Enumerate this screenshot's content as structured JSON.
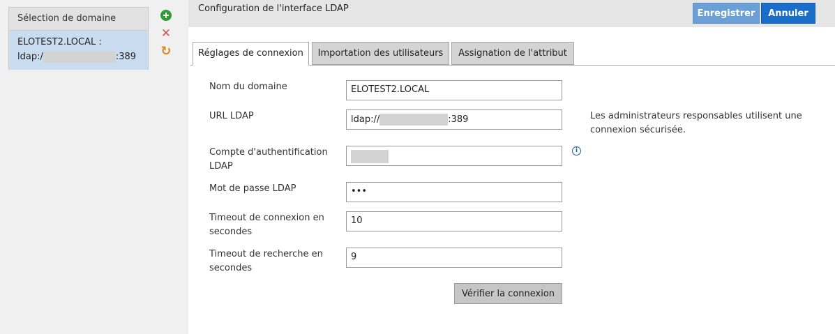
{
  "sidebar": {
    "header": "Sélection de domaine",
    "item_line1": "ELOTEST2.LOCAL :",
    "item_prefix": "ldap:/",
    "item_suffix": ":389"
  },
  "header": {
    "title": "Configuration de l'interface LDAP",
    "save_label": "Enregistrer",
    "cancel_label": "Annuler"
  },
  "tabs": [
    {
      "label": "Réglages de connexion",
      "active": true
    },
    {
      "label": "Importation des utilisateurs",
      "active": false
    },
    {
      "label": "Assignation de l'attribut",
      "active": false
    }
  ],
  "form": {
    "domain_label": "Nom du domaine",
    "domain_value": "ELOTEST2.LOCAL",
    "url_label": "URL LDAP",
    "url_prefix": "ldap://",
    "url_suffix": ":389",
    "account_label": "Compte d'authentification LDAP",
    "password_label": "Mot de passe LDAP",
    "password_value": "•••",
    "conn_timeout_label": "Timeout de connexion en secondes",
    "conn_timeout_value": "10",
    "search_timeout_label": "Timeout de recherche en secondes",
    "search_timeout_value": "9",
    "url_note": "Les administrateurs responsables utilisent une connexion sécurisée.",
    "verify_label": "Vérifier la connexion"
  },
  "icons": {
    "add": "plus-icon",
    "delete": "close-icon",
    "refresh": "refresh-icon",
    "info": "info-icon"
  }
}
